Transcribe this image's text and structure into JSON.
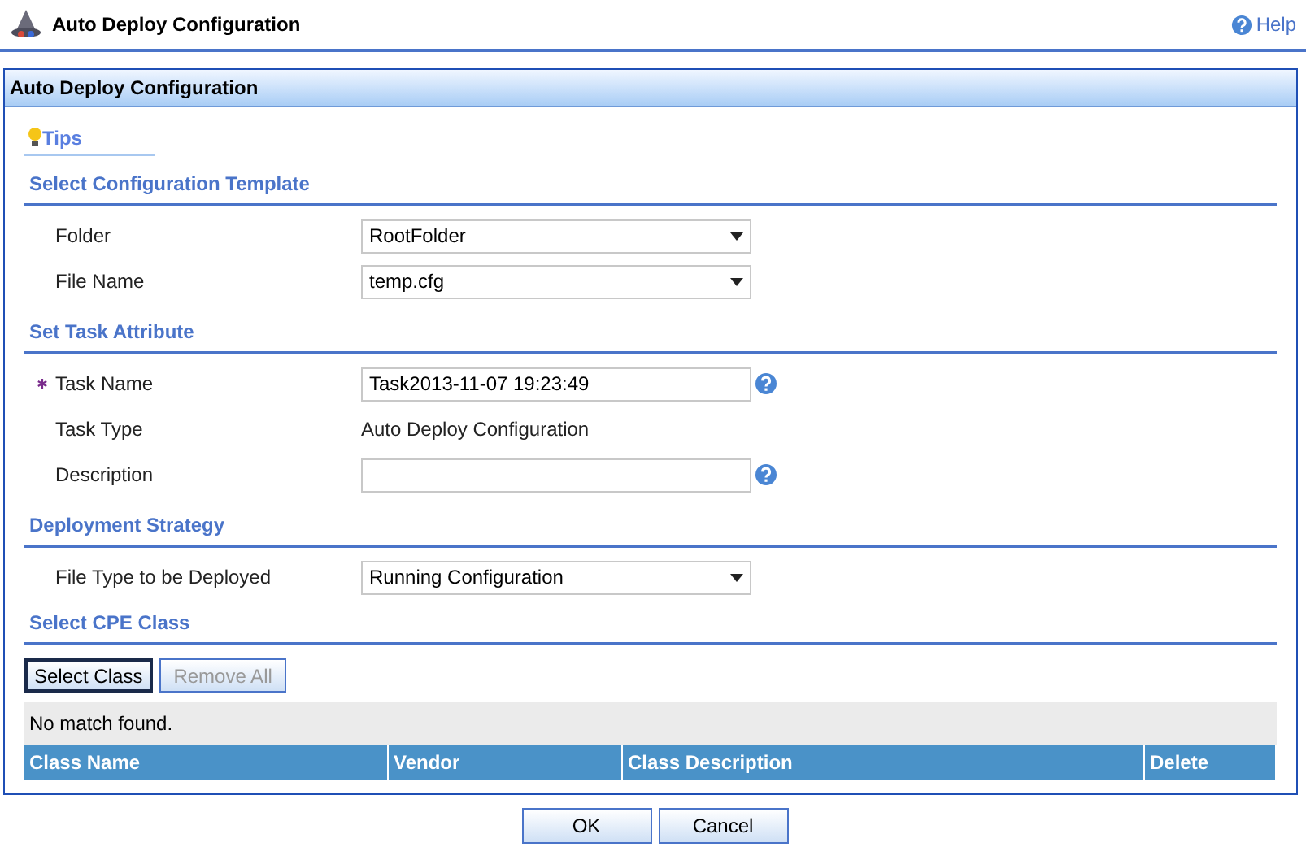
{
  "header": {
    "title": "Auto Deploy Configuration",
    "help": "Help"
  },
  "panel": {
    "title": "Auto Deploy Configuration",
    "tips": "Tips",
    "sections": [
      {
        "title": "Select Configuration Template",
        "fields": [
          {
            "label": "Folder",
            "kind": "select",
            "value": "RootFolder",
            "required": false,
            "help": false
          },
          {
            "label": "File Name",
            "kind": "select",
            "value": "temp.cfg",
            "required": false,
            "help": false
          }
        ]
      },
      {
        "title": "Set Task Attribute",
        "fields": [
          {
            "label": "Task Name",
            "kind": "input",
            "value": "Task2013-11-07 19:23:49",
            "required": true,
            "help": true
          },
          {
            "label": "Task Type",
            "kind": "text",
            "value": "Auto Deploy Configuration",
            "required": false,
            "help": false
          },
          {
            "label": "Description",
            "kind": "input",
            "required": false,
            "help": true
          }
        ]
      },
      {
        "title": "Deployment Strategy",
        "fields": [
          {
            "label": "File Type to be Deployed",
            "kind": "select",
            "value": "Running Configuration",
            "required": false,
            "help": false
          }
        ]
      }
    ],
    "cpe": {
      "title": "Select CPE Class",
      "buttons": [
        {
          "label": "Select Class",
          "disabled": false
        },
        {
          "label": "Remove All",
          "disabled": true
        }
      ],
      "message": "No match found.",
      "columns": [
        "Class Name",
        "Vendor",
        "Class Description",
        "Delete"
      ]
    }
  },
  "footer": {
    "buttons": [
      "OK",
      "Cancel"
    ]
  }
}
